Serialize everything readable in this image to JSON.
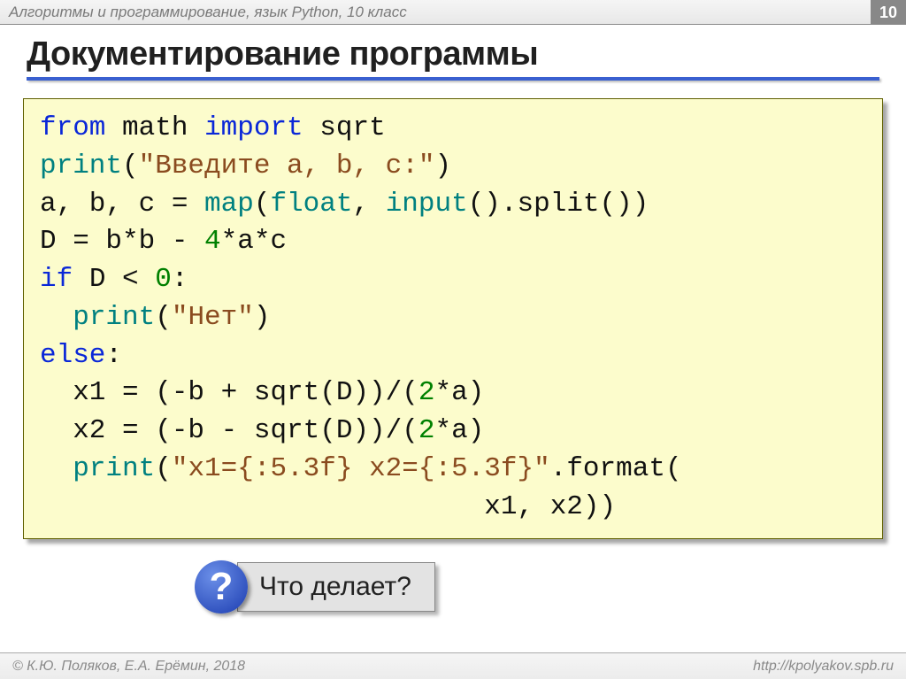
{
  "header": {
    "breadcrumb": "Алгоритмы и программирование, язык Python, 10 класс",
    "page_number": "10"
  },
  "title": "Документирование программы",
  "code": {
    "l1": {
      "a": "from",
      "b": " math ",
      "c": "import",
      "d": " sqrt"
    },
    "l2": {
      "a": "print",
      "b": "(",
      "c": "\"Введите a, b, c:\"",
      "d": ")"
    },
    "l3": {
      "a": "a, b, c = ",
      "b": "map",
      "c": "(",
      "d": "float",
      "e": ", ",
      "f": "input",
      "g": "().split())"
    },
    "l4": {
      "a": "D = b*b - ",
      "b": "4",
      "c": "*a*c"
    },
    "l5": {
      "a": "if",
      "b": " D < ",
      "c": "0",
      "d": ":"
    },
    "l6": {
      "a": "  ",
      "b": "print",
      "c": "(",
      "d": "\"Нет\"",
      "e": ")"
    },
    "l7": {
      "a": "else",
      "b": ":"
    },
    "l8": {
      "a": "  x1 = (-b + sqrt(D))/(",
      "b": "2",
      "c": "*a)"
    },
    "l9": {
      "a": "  x2 = (-b - sqrt(D))/(",
      "b": "2",
      "c": "*a)"
    },
    "l10": {
      "a": "  ",
      "b": "print",
      "c": "(",
      "d": "\"x1={:5.3f} x2={:5.3f}\"",
      "e": ".format("
    },
    "l11": "                           x1, x2))"
  },
  "question": {
    "mark": "?",
    "text": "Что делает?"
  },
  "footer": {
    "copyright": "© К.Ю. Поляков, Е.А. Ерёмин, 2018",
    "url": "http://kpolyakov.spb.ru"
  }
}
